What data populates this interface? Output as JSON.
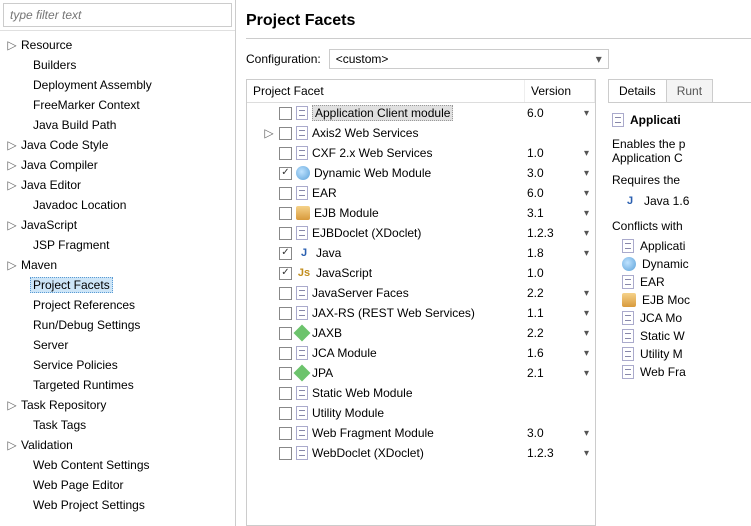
{
  "filter_placeholder": "type filter text",
  "sidebar": [
    {
      "label": "Resource",
      "expandable": true
    },
    {
      "label": "Builders",
      "expandable": false,
      "indent": 1
    },
    {
      "label": "Deployment Assembly",
      "expandable": false,
      "indent": 1
    },
    {
      "label": "FreeMarker Context",
      "expandable": false,
      "indent": 1
    },
    {
      "label": "Java Build Path",
      "expandable": false,
      "indent": 1
    },
    {
      "label": "Java Code Style",
      "expandable": true
    },
    {
      "label": "Java Compiler",
      "expandable": true
    },
    {
      "label": "Java Editor",
      "expandable": true
    },
    {
      "label": "Javadoc Location",
      "expandable": false,
      "indent": 1
    },
    {
      "label": "JavaScript",
      "expandable": true
    },
    {
      "label": "JSP Fragment",
      "expandable": false,
      "indent": 1
    },
    {
      "label": "Maven",
      "expandable": true
    },
    {
      "label": "Project Facets",
      "expandable": false,
      "indent": 1,
      "selected": true
    },
    {
      "label": "Project References",
      "expandable": false,
      "indent": 1
    },
    {
      "label": "Run/Debug Settings",
      "expandable": false,
      "indent": 1
    },
    {
      "label": "Server",
      "expandable": false,
      "indent": 1
    },
    {
      "label": "Service Policies",
      "expandable": false,
      "indent": 1
    },
    {
      "label": "Targeted Runtimes",
      "expandable": false,
      "indent": 1
    },
    {
      "label": "Task Repository",
      "expandable": true
    },
    {
      "label": "Task Tags",
      "expandable": false,
      "indent": 1
    },
    {
      "label": "Validation",
      "expandable": true
    },
    {
      "label": "Web Content Settings",
      "expandable": false,
      "indent": 1
    },
    {
      "label": "Web Page Editor",
      "expandable": false,
      "indent": 1
    },
    {
      "label": "Web Project Settings",
      "expandable": false,
      "indent": 1
    }
  ],
  "page_title": "Project Facets",
  "config_label": "Configuration:",
  "config_value": "<custom>",
  "columns": {
    "name": "Project Facet",
    "version": "Version"
  },
  "facets": [
    {
      "name": "Application Client module",
      "version": "6.0",
      "checked": false,
      "icon": "page",
      "selected": true,
      "hasVersion": true
    },
    {
      "name": "Axis2 Web Services",
      "version": "",
      "checked": false,
      "icon": "page",
      "expandable": true,
      "hasVersion": false
    },
    {
      "name": "CXF 2.x Web Services",
      "version": "1.0",
      "checked": false,
      "icon": "page",
      "hasVersion": true
    },
    {
      "name": "Dynamic Web Module",
      "version": "3.0",
      "checked": true,
      "icon": "globe",
      "hasVersion": true
    },
    {
      "name": "EAR",
      "version": "6.0",
      "checked": false,
      "icon": "page",
      "hasVersion": true
    },
    {
      "name": "EJB Module",
      "version": "3.1",
      "checked": false,
      "icon": "ejb",
      "hasVersion": true
    },
    {
      "name": "EJBDoclet (XDoclet)",
      "version": "1.2.3",
      "checked": false,
      "icon": "page",
      "hasVersion": true
    },
    {
      "name": "Java",
      "version": "1.8",
      "checked": true,
      "icon": "java-lib",
      "hasVersion": true
    },
    {
      "name": "JavaScript",
      "version": "1.0",
      "checked": true,
      "icon": "js",
      "hasVersion": false
    },
    {
      "name": "JavaServer Faces",
      "version": "2.2",
      "checked": false,
      "icon": "page",
      "hasVersion": true
    },
    {
      "name": "JAX-RS (REST Web Services)",
      "version": "1.1",
      "checked": false,
      "icon": "page",
      "hasVersion": true
    },
    {
      "name": "JAXB",
      "version": "2.2",
      "checked": false,
      "icon": "diamond",
      "hasVersion": true
    },
    {
      "name": "JCA Module",
      "version": "1.6",
      "checked": false,
      "icon": "page",
      "hasVersion": true
    },
    {
      "name": "JPA",
      "version": "2.1",
      "checked": false,
      "icon": "diamond",
      "hasVersion": true
    },
    {
      "name": "Static Web Module",
      "version": "",
      "checked": false,
      "icon": "page",
      "hasVersion": false
    },
    {
      "name": "Utility Module",
      "version": "",
      "checked": false,
      "icon": "page",
      "hasVersion": false
    },
    {
      "name": "Web Fragment Module",
      "version": "3.0",
      "checked": false,
      "icon": "page",
      "hasVersion": true
    },
    {
      "name": "WebDoclet (XDoclet)",
      "version": "1.2.3",
      "checked": false,
      "icon": "page",
      "hasVersion": true
    }
  ],
  "details": {
    "tabs": [
      "Details",
      "Runt"
    ],
    "heading": "Applicati",
    "desc1": "Enables the p",
    "desc2": "Application C",
    "requires_label": "Requires the",
    "requires": [
      {
        "label": "Java 1.6",
        "icon": "java-lib"
      }
    ],
    "conflicts_label": "Conflicts with",
    "conflicts": [
      {
        "label": "Applicati",
        "icon": "page"
      },
      {
        "label": "Dynamic",
        "icon": "globe"
      },
      {
        "label": "EAR",
        "icon": "page"
      },
      {
        "label": "EJB Moc",
        "icon": "ejb"
      },
      {
        "label": "JCA Mo",
        "icon": "page"
      },
      {
        "label": "Static W",
        "icon": "page"
      },
      {
        "label": "Utility M",
        "icon": "page"
      },
      {
        "label": "Web Fra",
        "icon": "page"
      }
    ]
  }
}
